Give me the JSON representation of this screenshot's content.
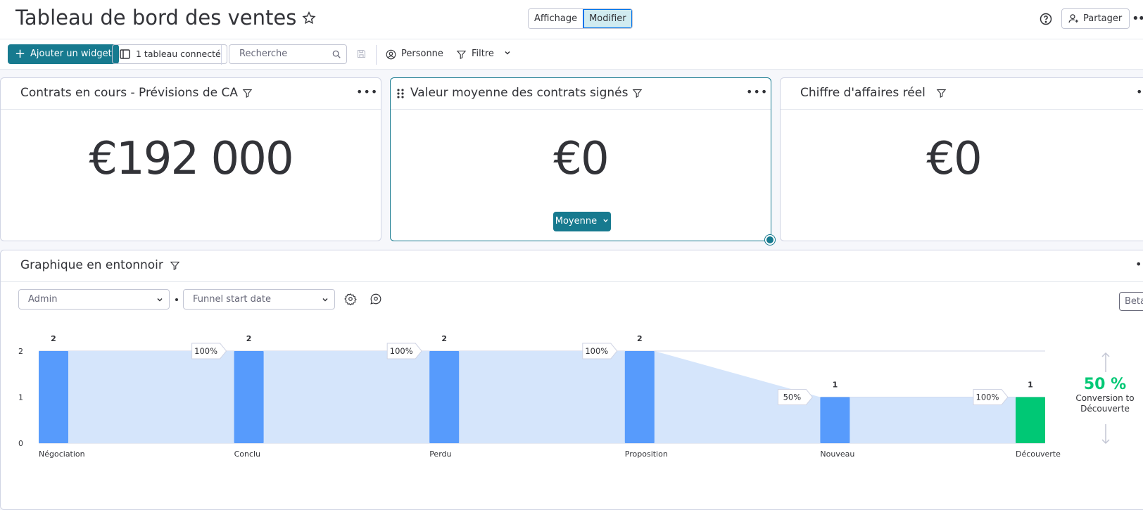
{
  "header": {
    "title": "Tableau de bord des ventes",
    "view_label": "Affichage",
    "edit_label": "Modifier",
    "share_label": "Partager"
  },
  "toolbar": {
    "add_widget_label": "Ajouter un widget",
    "connected_label": "1 tableau connecté",
    "search_placeholder": "Recherche",
    "person_label": "Personne",
    "filter_label": "Filtre"
  },
  "widgets": [
    {
      "title": "Contrats en cours - Prévisions de CA",
      "value": "€192 000"
    },
    {
      "title": "Valeur moyenne des contrats signés",
      "value": "€0",
      "button_label": "Moyenne"
    },
    {
      "title": "Chiffre d'affaires réel",
      "value": "€0"
    }
  ],
  "funnel": {
    "title": "Graphique en entonnoir",
    "dropdown_1": "Admin",
    "dropdown_2": "Funnel start date",
    "beta_label": "Beta",
    "conversion_pct": "50 %",
    "conversion_label_1": "Conversion to",
    "conversion_label_2": "Découverte"
  },
  "colors": {
    "accent": "#177a8f",
    "bar": "#579bfc",
    "bar_last": "#00c875",
    "area": "#d5e5fb"
  },
  "chart_data": {
    "type": "bar",
    "categories": [
      "Négociation",
      "Conclu",
      "Perdu",
      "Proposition",
      "Nouveau",
      "Découverte"
    ],
    "values": [
      2,
      2,
      2,
      2,
      1,
      1
    ],
    "step_percentages": [
      "",
      "100%",
      "100%",
      "100%",
      "50%",
      "100%"
    ],
    "ylim": [
      0,
      2
    ],
    "yticks": [
      0,
      1,
      2
    ],
    "grid": true
  }
}
